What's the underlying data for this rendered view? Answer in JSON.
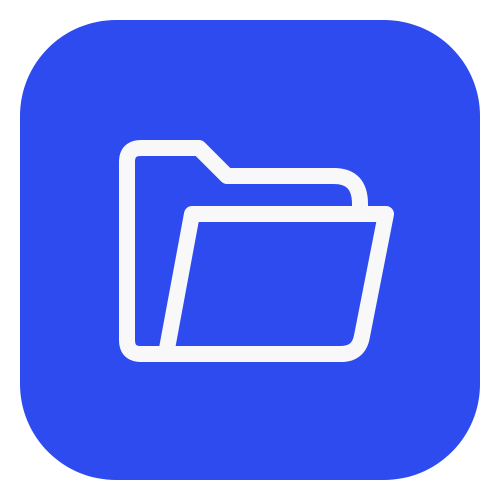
{
  "app_icon": {
    "background_color": "#2d4bef",
    "glyph": {
      "icon": "folder-open-icon",
      "color": "#f8f8f8"
    }
  }
}
